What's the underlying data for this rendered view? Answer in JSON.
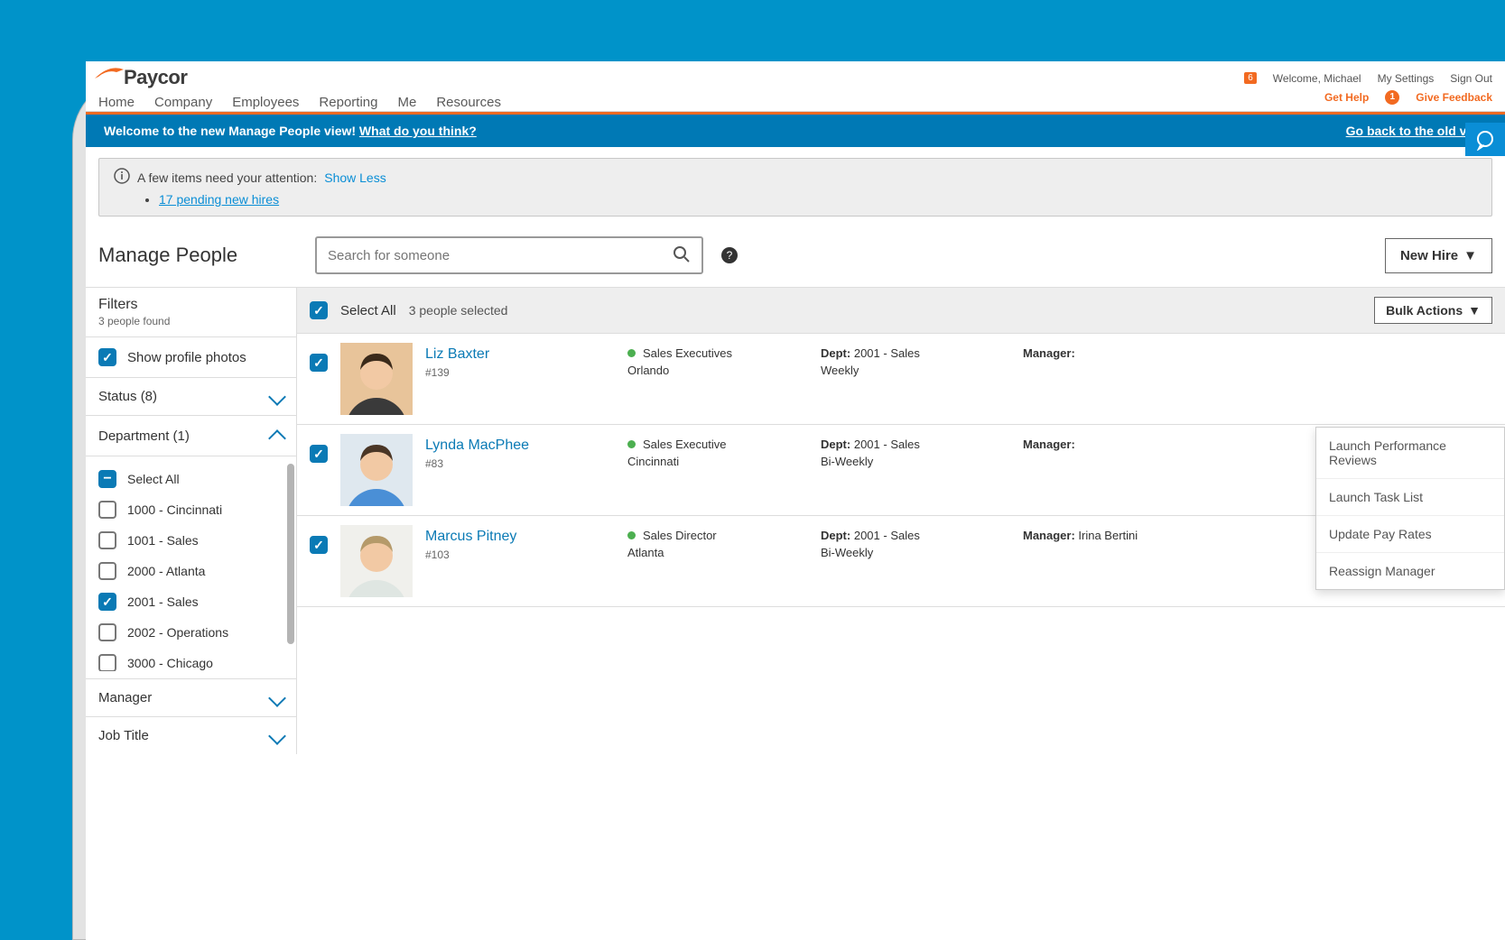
{
  "brand": "Paycor",
  "nav": [
    "Home",
    "Company",
    "Employees",
    "Reporting",
    "Me",
    "Resources"
  ],
  "header": {
    "welcome_badge": "6",
    "welcome": "Welcome, Michael",
    "settings": "My Settings",
    "signout": "Sign Out",
    "gethelp": "Get Help",
    "gethelp_badge": "1",
    "feedback": "Give Feedback"
  },
  "banner": {
    "left_a": "Welcome to the new Manage People view! ",
    "left_link": "What do you think?",
    "right": "Go back to the old view"
  },
  "alert": {
    "text": "A few items need your attention: ",
    "toggle": "Show Less",
    "items": [
      "17 pending new hires"
    ]
  },
  "page": {
    "title": "Manage People",
    "search_placeholder": "Search for someone",
    "new_hire": "New Hire"
  },
  "filters": {
    "title": "Filters",
    "found": "3 people found",
    "show_photos": "Show profile photos",
    "status_label": "Status (8)",
    "dept_label": "Department (1)",
    "manager_label": "Manager",
    "jobtitle_label": "Job Title",
    "dept_select_all": "Select All",
    "departments": [
      {
        "label": "1000 - Cincinnati",
        "checked": false
      },
      {
        "label": "1001 - Sales",
        "checked": false
      },
      {
        "label": "2000 - Atlanta",
        "checked": false
      },
      {
        "label": "2001 - Sales",
        "checked": true
      },
      {
        "label": "2002 - Operations",
        "checked": false
      },
      {
        "label": "3000 - Chicago",
        "checked": false
      }
    ]
  },
  "list": {
    "select_all": "Select All",
    "selected_text": "3 people selected",
    "bulk_label": "Bulk Actions",
    "bulk_items": [
      "Launch Performance Reviews",
      "Launch Task List",
      "Update Pay Rates",
      "Reassign Manager"
    ],
    "dept_prefix": "Dept: ",
    "mgr_prefix": "Manager: ",
    "people": [
      {
        "name": "Liz Baxter",
        "id": "#139",
        "role": "Sales Executives",
        "city": "Orlando",
        "dept": "2001 - Sales",
        "freq": "Weekly",
        "manager": ""
      },
      {
        "name": "Lynda MacPhee",
        "id": "#83",
        "role": "Sales Executive",
        "city": "Cincinnati",
        "dept": "2001 - Sales",
        "freq": "Bi-Weekly",
        "manager": ""
      },
      {
        "name": "Marcus Pitney",
        "id": "#103",
        "role": "Sales Director",
        "city": "Atlanta",
        "dept": "2001 - Sales",
        "freq": "Bi-Weekly",
        "manager": "Irina Bertini"
      }
    ]
  },
  "avatar_colors": [
    {
      "bg": "#e8c49a",
      "shirt": "#3a3a3a",
      "hair": "#3b2a1a"
    },
    {
      "bg": "#dfe8ef",
      "shirt": "#4a8fd6",
      "hair": "#4a3626"
    },
    {
      "bg": "#f0f0ec",
      "shirt": "#dfe6e2",
      "hair": "#b59a6a"
    }
  ]
}
